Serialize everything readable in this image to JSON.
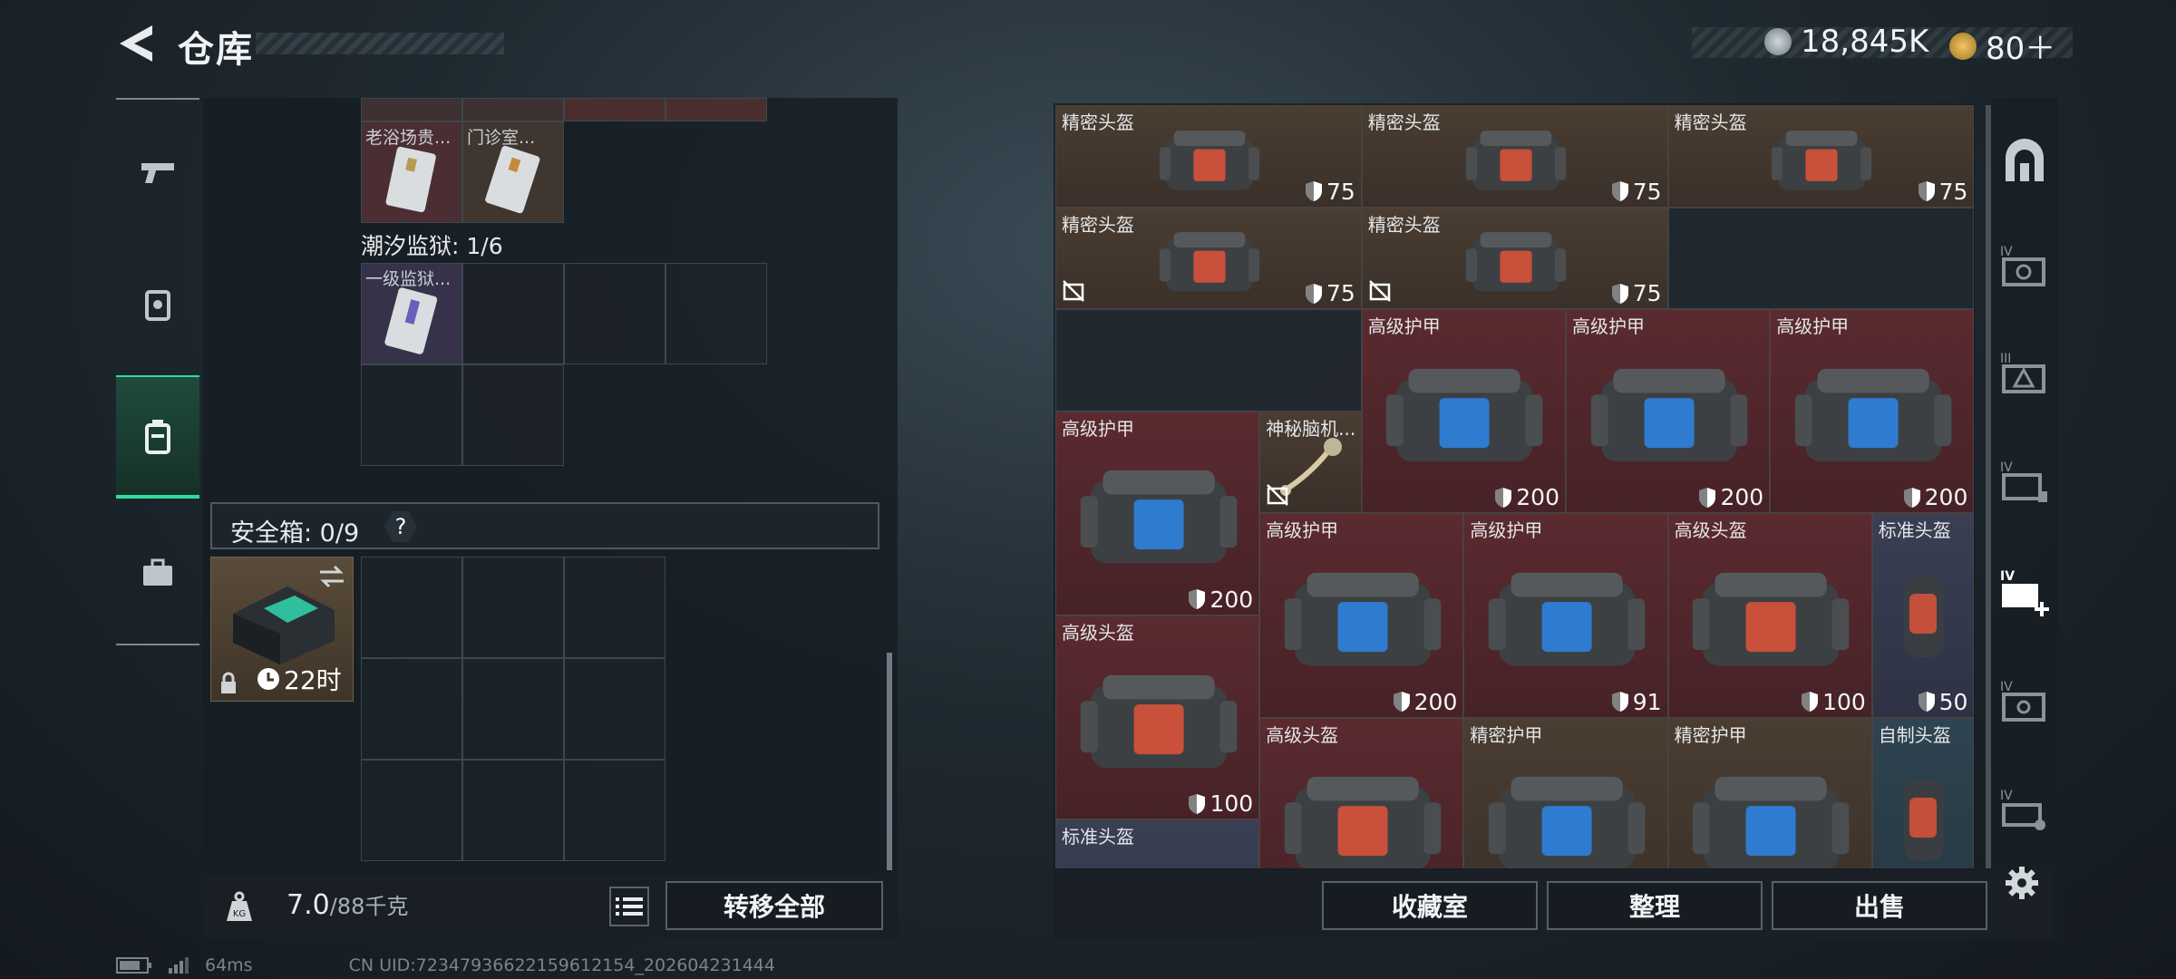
{
  "header": {
    "title": "仓库"
  },
  "currency": {
    "coins": "18,845K",
    "tickets": "80＋",
    "coin_color": "#9aa7b3",
    "ticket_color": "#d7a43e"
  },
  "left": {
    "top_item_labels": [
      "老浴场贵...",
      "门诊室..."
    ],
    "prison_label": "潮汐监狱: 1/6",
    "prison_item": "一级监狱...",
    "safe_label": "安全箱: 0/9",
    "safe_help": "?",
    "case_timer": "22时",
    "weight_value": "7.0",
    "weight_max": "/88千克",
    "transfer_all": "转移全部"
  },
  "items": [
    {
      "name": "精密头盔",
      "dur": "75"
    },
    {
      "name": "精密头盔",
      "dur": "75"
    },
    {
      "name": "精密头盔",
      "dur": "75"
    },
    {
      "name": "精密头盔",
      "dur": "75"
    },
    {
      "name": "精密头盔",
      "dur": "75"
    },
    {
      "name": "高级护甲",
      "dur": "200"
    },
    {
      "name": "高级护甲",
      "dur": "200"
    },
    {
      "name": "高级护甲",
      "dur": "200"
    },
    {
      "name": "高级护甲",
      "dur": "200"
    },
    {
      "name": "神秘脑机..."
    },
    {
      "name": "高级护甲",
      "dur": "200"
    },
    {
      "name": "高级护甲",
      "dur": "91"
    },
    {
      "name": "高级头盔",
      "dur": "100"
    },
    {
      "name": "标准头盔",
      "dur": "50"
    },
    {
      "name": "高级头盔",
      "dur": "100"
    },
    {
      "name": "高级头盔"
    },
    {
      "name": "精密护甲"
    },
    {
      "name": "精密护甲"
    },
    {
      "name": "自制头盔"
    },
    {
      "name": "标准头盔"
    }
  ],
  "buttons": {
    "collection": "收藏室",
    "organize": "整理",
    "sell": "出售"
  },
  "status": {
    "ping": "64ms",
    "uid": "CN UID:7234793662215961215​4_202604231444"
  }
}
